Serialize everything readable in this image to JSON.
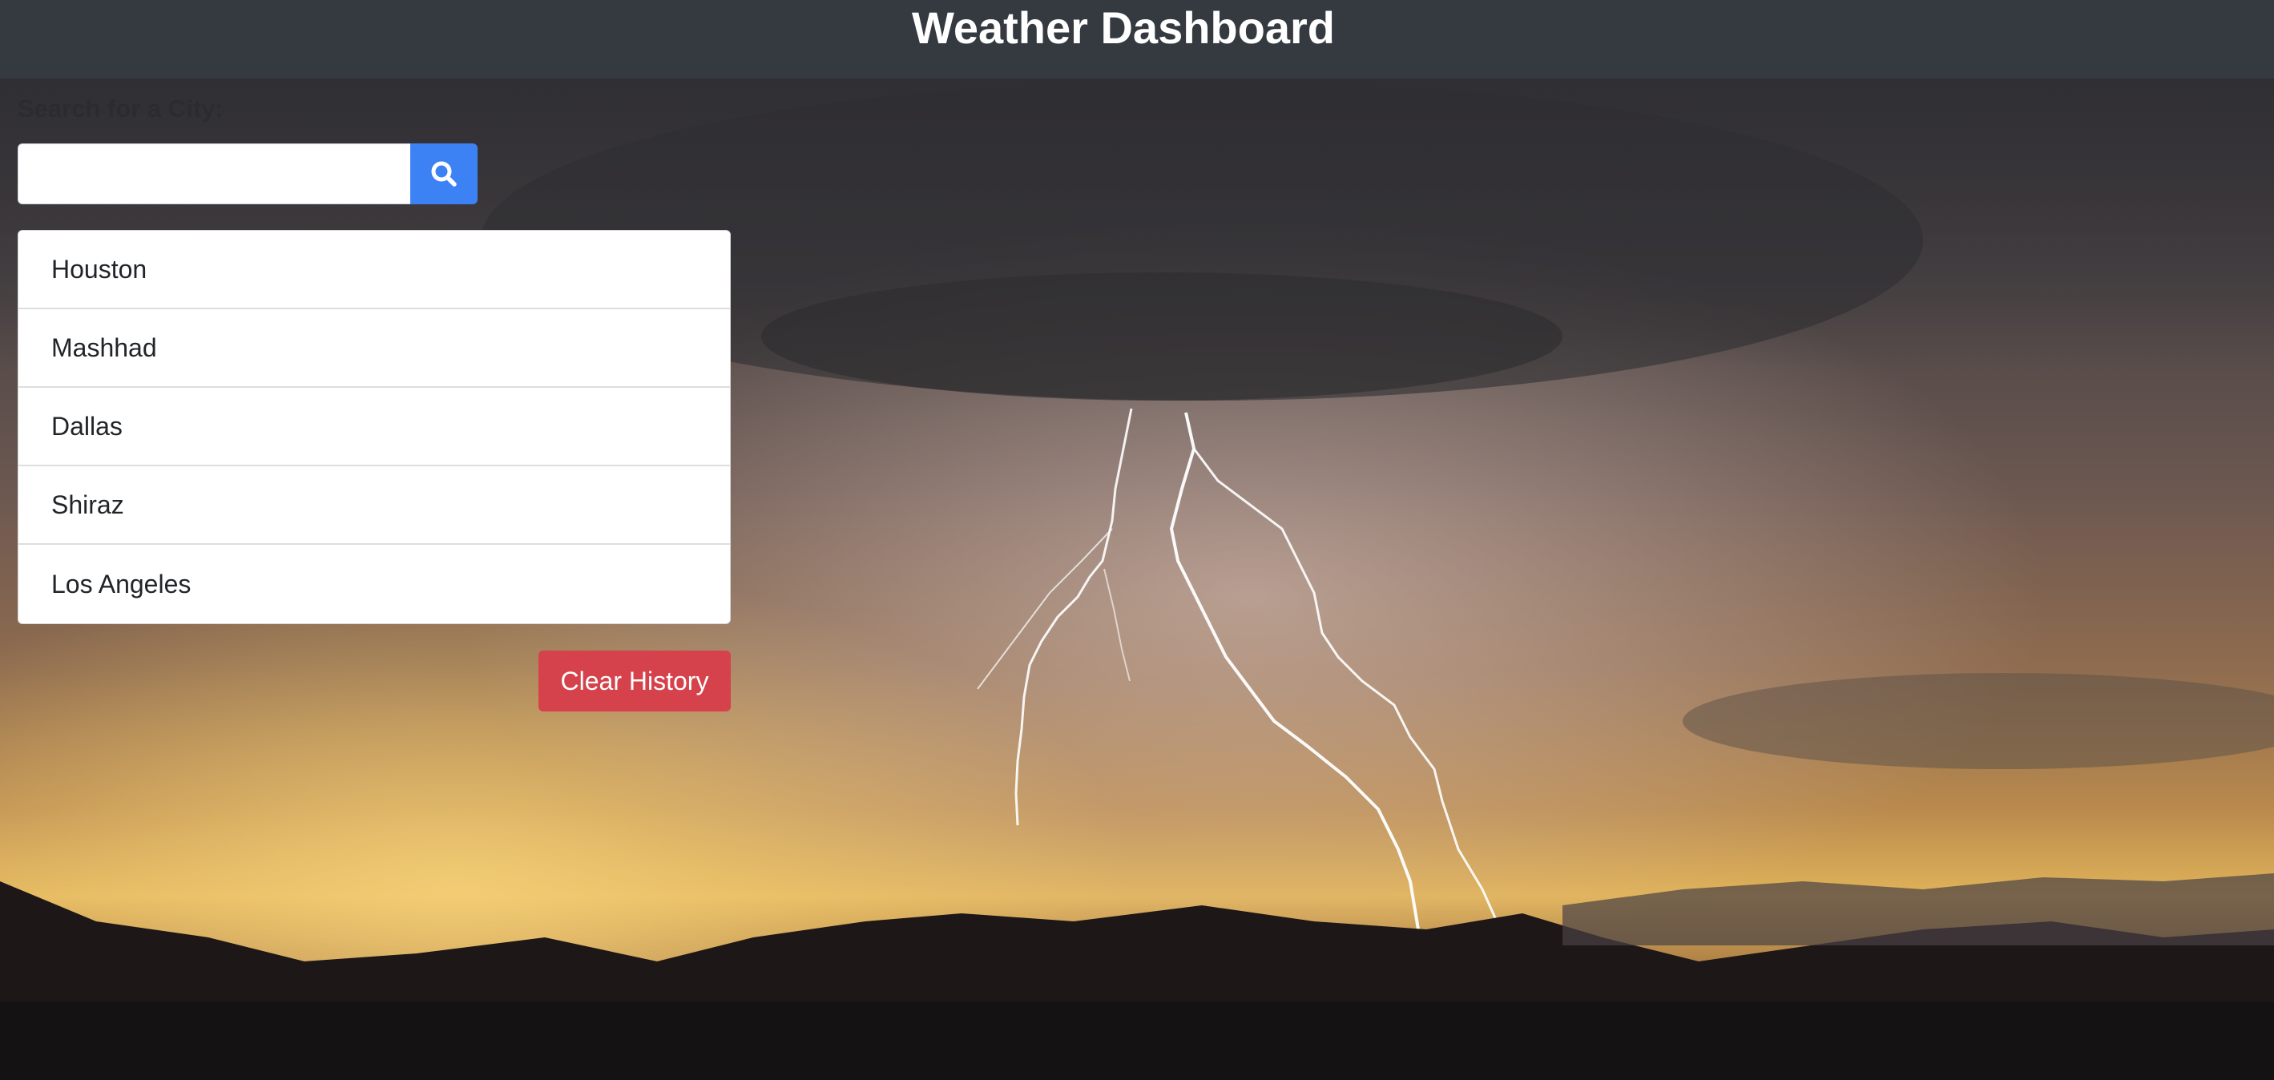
{
  "header": {
    "title": "Weather Dashboard"
  },
  "search": {
    "label": "Search for a City:",
    "value": "",
    "placeholder": "",
    "button_icon": "search-icon"
  },
  "history": {
    "items": [
      {
        "label": "Houston"
      },
      {
        "label": "Mashhad"
      },
      {
        "label": "Dallas"
      },
      {
        "label": "Shiraz"
      },
      {
        "label": "Los Angeles"
      }
    ],
    "clear_label": "Clear History"
  },
  "colors": {
    "header_bg": "#343a40",
    "search_button": "#3d82f5",
    "clear_button": "#d5424b"
  },
  "background": {
    "scene": "lightning-storm-sunset"
  }
}
